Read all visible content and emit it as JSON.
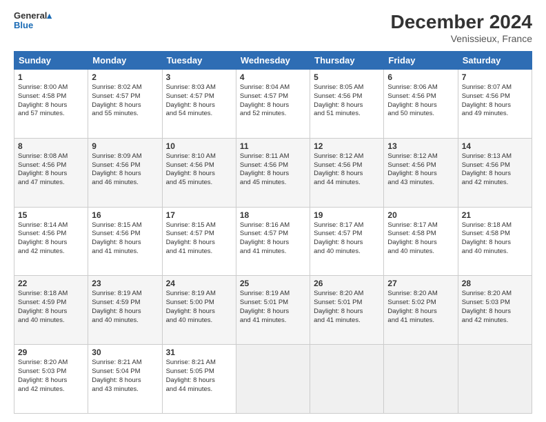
{
  "header": {
    "logo_line1": "General",
    "logo_line2": "Blue",
    "title": "December 2024",
    "subtitle": "Venissieux, France"
  },
  "days_of_week": [
    "Sunday",
    "Monday",
    "Tuesday",
    "Wednesday",
    "Thursday",
    "Friday",
    "Saturday"
  ],
  "weeks": [
    [
      {
        "day": "1",
        "sunrise": "8:00 AM",
        "sunset": "4:58 PM",
        "daylight": "8 hours and 57 minutes."
      },
      {
        "day": "2",
        "sunrise": "8:02 AM",
        "sunset": "4:57 PM",
        "daylight": "8 hours and 55 minutes."
      },
      {
        "day": "3",
        "sunrise": "8:03 AM",
        "sunset": "4:57 PM",
        "daylight": "8 hours and 54 minutes."
      },
      {
        "day": "4",
        "sunrise": "8:04 AM",
        "sunset": "4:57 PM",
        "daylight": "8 hours and 52 minutes."
      },
      {
        "day": "5",
        "sunrise": "8:05 AM",
        "sunset": "4:56 PM",
        "daylight": "8 hours and 51 minutes."
      },
      {
        "day": "6",
        "sunrise": "8:06 AM",
        "sunset": "4:56 PM",
        "daylight": "8 hours and 50 minutes."
      },
      {
        "day": "7",
        "sunrise": "8:07 AM",
        "sunset": "4:56 PM",
        "daylight": "8 hours and 49 minutes."
      }
    ],
    [
      {
        "day": "8",
        "sunrise": "8:08 AM",
        "sunset": "4:56 PM",
        "daylight": "8 hours and 47 minutes."
      },
      {
        "day": "9",
        "sunrise": "8:09 AM",
        "sunset": "4:56 PM",
        "daylight": "8 hours and 46 minutes."
      },
      {
        "day": "10",
        "sunrise": "8:10 AM",
        "sunset": "4:56 PM",
        "daylight": "8 hours and 45 minutes."
      },
      {
        "day": "11",
        "sunrise": "8:11 AM",
        "sunset": "4:56 PM",
        "daylight": "8 hours and 45 minutes."
      },
      {
        "day": "12",
        "sunrise": "8:12 AM",
        "sunset": "4:56 PM",
        "daylight": "8 hours and 44 minutes."
      },
      {
        "day": "13",
        "sunrise": "8:12 AM",
        "sunset": "4:56 PM",
        "daylight": "8 hours and 43 minutes."
      },
      {
        "day": "14",
        "sunrise": "8:13 AM",
        "sunset": "4:56 PM",
        "daylight": "8 hours and 42 minutes."
      }
    ],
    [
      {
        "day": "15",
        "sunrise": "8:14 AM",
        "sunset": "4:56 PM",
        "daylight": "8 hours and 42 minutes."
      },
      {
        "day": "16",
        "sunrise": "8:15 AM",
        "sunset": "4:56 PM",
        "daylight": "8 hours and 41 minutes."
      },
      {
        "day": "17",
        "sunrise": "8:15 AM",
        "sunset": "4:57 PM",
        "daylight": "8 hours and 41 minutes."
      },
      {
        "day": "18",
        "sunrise": "8:16 AM",
        "sunset": "4:57 PM",
        "daylight": "8 hours and 41 minutes."
      },
      {
        "day": "19",
        "sunrise": "8:17 AM",
        "sunset": "4:57 PM",
        "daylight": "8 hours and 40 minutes."
      },
      {
        "day": "20",
        "sunrise": "8:17 AM",
        "sunset": "4:58 PM",
        "daylight": "8 hours and 40 minutes."
      },
      {
        "day": "21",
        "sunrise": "8:18 AM",
        "sunset": "4:58 PM",
        "daylight": "8 hours and 40 minutes."
      }
    ],
    [
      {
        "day": "22",
        "sunrise": "8:18 AM",
        "sunset": "4:59 PM",
        "daylight": "8 hours and 40 minutes."
      },
      {
        "day": "23",
        "sunrise": "8:19 AM",
        "sunset": "4:59 PM",
        "daylight": "8 hours and 40 minutes."
      },
      {
        "day": "24",
        "sunrise": "8:19 AM",
        "sunset": "5:00 PM",
        "daylight": "8 hours and 40 minutes."
      },
      {
        "day": "25",
        "sunrise": "8:19 AM",
        "sunset": "5:01 PM",
        "daylight": "8 hours and 41 minutes."
      },
      {
        "day": "26",
        "sunrise": "8:20 AM",
        "sunset": "5:01 PM",
        "daylight": "8 hours and 41 minutes."
      },
      {
        "day": "27",
        "sunrise": "8:20 AM",
        "sunset": "5:02 PM",
        "daylight": "8 hours and 41 minutes."
      },
      {
        "day": "28",
        "sunrise": "8:20 AM",
        "sunset": "5:03 PM",
        "daylight": "8 hours and 42 minutes."
      }
    ],
    [
      {
        "day": "29",
        "sunrise": "8:20 AM",
        "sunset": "5:03 PM",
        "daylight": "8 hours and 42 minutes."
      },
      {
        "day": "30",
        "sunrise": "8:21 AM",
        "sunset": "5:04 PM",
        "daylight": "8 hours and 43 minutes."
      },
      {
        "day": "31",
        "sunrise": "8:21 AM",
        "sunset": "5:05 PM",
        "daylight": "8 hours and 44 minutes."
      },
      null,
      null,
      null,
      null
    ]
  ],
  "labels": {
    "sunrise": "Sunrise:",
    "sunset": "Sunset:",
    "daylight": "Daylight:"
  }
}
